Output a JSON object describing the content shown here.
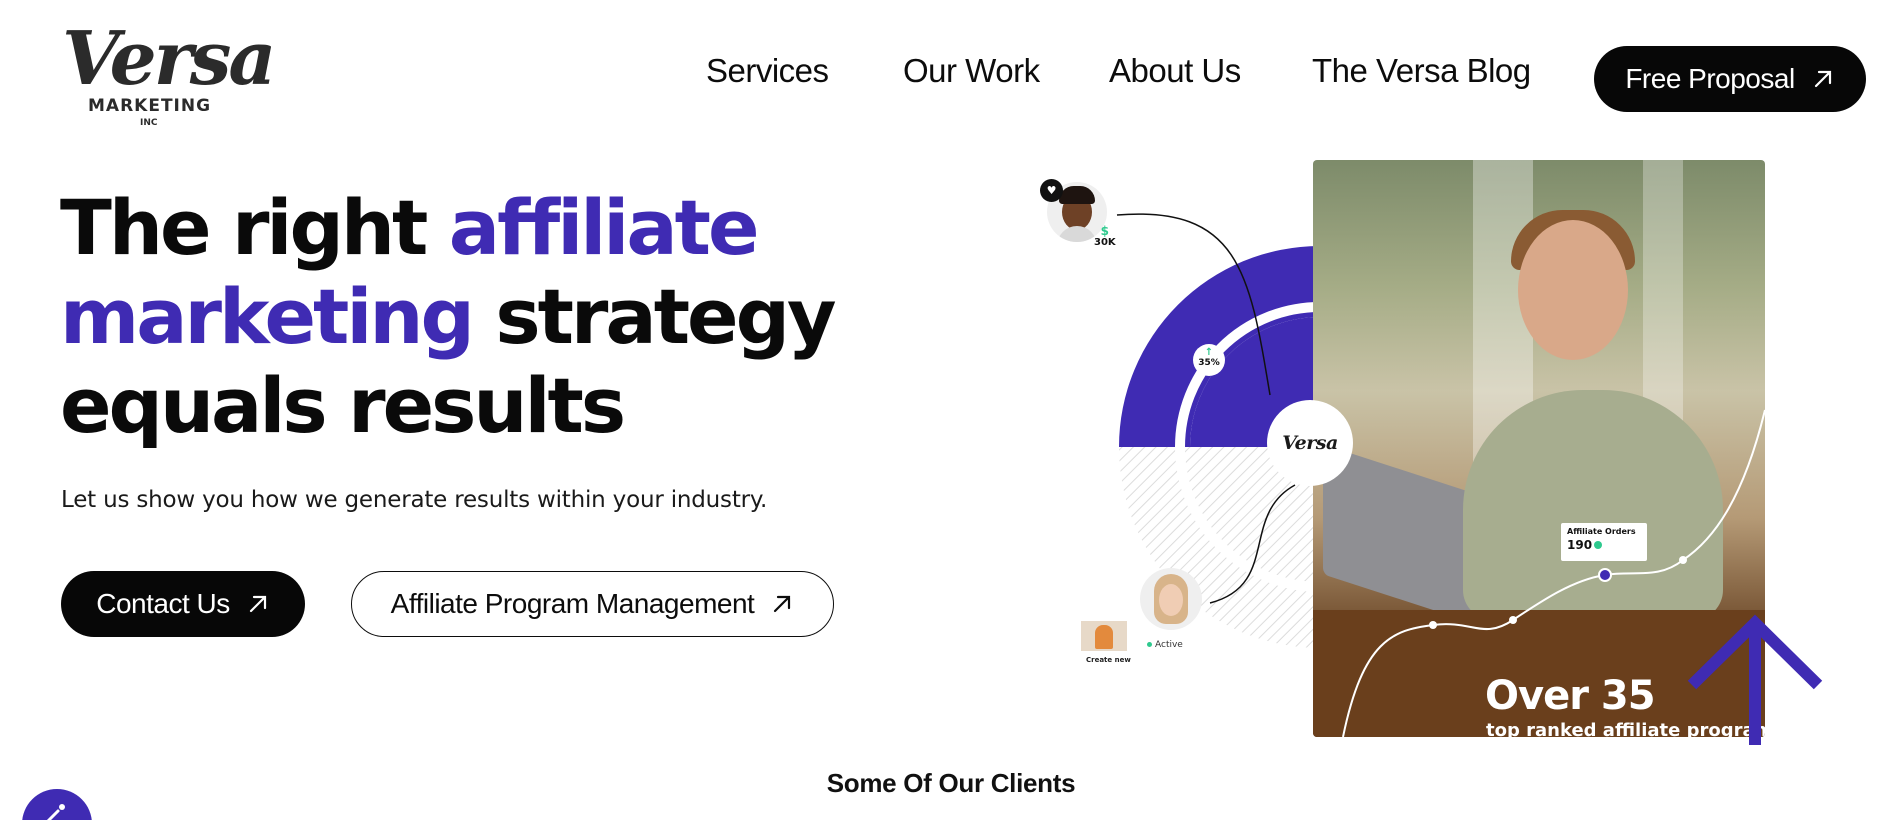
{
  "brand": {
    "logo_script": "Versa",
    "logo_sub": "MARKETING",
    "logo_inc": "INC"
  },
  "nav": {
    "items": [
      {
        "label": "Services"
      },
      {
        "label": "Our Work"
      },
      {
        "label": "About Us"
      },
      {
        "label": "The Versa Blog"
      }
    ],
    "cta_label": "Free Proposal",
    "cta_icon": "arrow-up-right-icon"
  },
  "hero": {
    "title_part1": "The right ",
    "title_accent1": "affiliate",
    "title_accent2": "marketing",
    "title_part2": " strategy",
    "title_part3": "equals results",
    "subtitle": "Let us show you how we generate results within your industry.",
    "primary_button": "Contact Us",
    "secondary_button": "Affiliate Program Management",
    "button_icon": "arrow-up-right-icon"
  },
  "graphic": {
    "money_label": "30K",
    "money_symbol": "$",
    "growth_label": "35%",
    "growth_icon": "arrow-up-icon",
    "badge_logo": "Versa",
    "orders_label": "Affiliate Orders",
    "orders_value": "190",
    "status_label": "Active",
    "create_label": "Create new",
    "stat_title": "Over 35",
    "stat_subtitle": "top ranked affiliate programs",
    "heart_icon": "heart-icon"
  },
  "clients": {
    "title": "Some Of Our Clients"
  },
  "colors": {
    "accent": "#3f2bb3",
    "dark": "#070707",
    "success": "#2ec98e"
  },
  "chat_widget": {
    "icon": "chat-widget-icon"
  }
}
